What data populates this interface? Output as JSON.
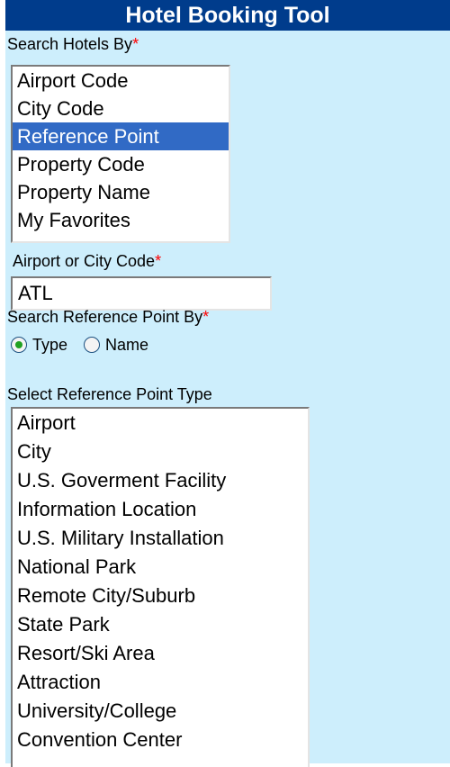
{
  "header": {
    "title": "Hotel Booking Tool"
  },
  "search_by": {
    "label": "Search Hotels By",
    "required_marker": "*",
    "options": [
      {
        "label": "Airport Code",
        "selected": false
      },
      {
        "label": "City Code",
        "selected": false
      },
      {
        "label": "Reference Point",
        "selected": true
      },
      {
        "label": "Property Code",
        "selected": false
      },
      {
        "label": "Property Name",
        "selected": false
      },
      {
        "label": "My Favorites",
        "selected": false
      }
    ]
  },
  "code_field": {
    "label": "Airport or City Code",
    "required_marker": "*",
    "value": "ATL"
  },
  "ref_point_by": {
    "label": "Search Reference Point By",
    "required_marker": "*",
    "options": [
      {
        "label": "Type",
        "checked": true
      },
      {
        "label": "Name",
        "checked": false
      }
    ]
  },
  "ref_point_type": {
    "label": "Select Reference Point Type",
    "options": [
      "Airport",
      "City",
      "U.S. Goverment Facility",
      "Information Location",
      "U.S. Military Installation",
      "National Park",
      "Remote City/Suburb",
      "State Park",
      "Resort/Ski Area",
      "Attraction",
      "University/College",
      "Convention Center"
    ]
  },
  "colors": {
    "panel_bg": "#cdeefc",
    "title_bg": "#003c8c",
    "selection": "#316ac5",
    "required": "#ff0000",
    "radio_dot": "#21a121"
  }
}
